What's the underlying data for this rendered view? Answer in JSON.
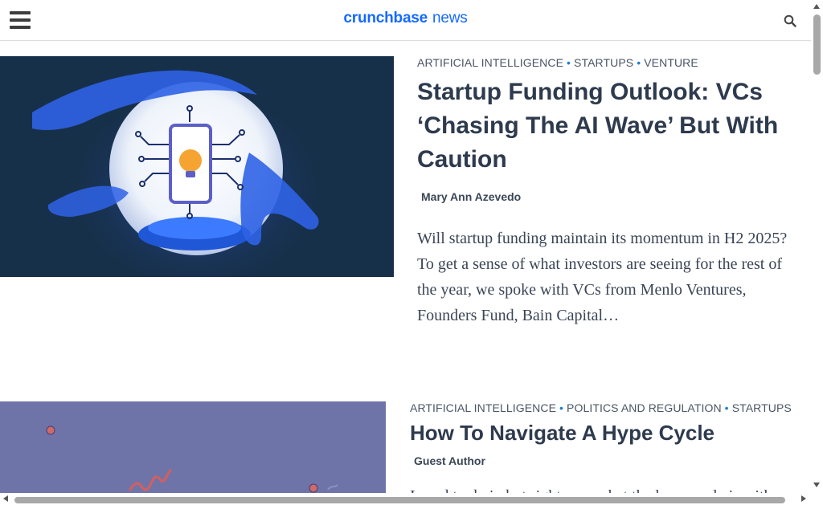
{
  "header": {
    "brand": "crunchbase",
    "news": "news",
    "menu_icon": "hamburger-menu-icon",
    "search_icon": "search-icon",
    "accent_color": "#146aff"
  },
  "articles": [
    {
      "categories": [
        "ARTIFICIAL INTELLIGENCE",
        "STARTUPS",
        "VENTURE"
      ],
      "title": "Startup Funding Outlook: VCs ‘Chasing The AI Wave’ But With Caution",
      "author": "Mary Ann Azevedo",
      "excerpt": "Will startup funding maintain its momentum in H2 2025? To get a sense of what investors are seeing for the rest of the year, we spoke with VCs from Menlo Ventures, Founders Fund, Bain Capital…"
    },
    {
      "categories": [
        "ARTIFICIAL INTELLIGENCE",
        "POLITICS AND REGULATION",
        "STARTUPS"
      ],
      "title": "How To Navigate A Hype Cycle",
      "author": "Guest Author",
      "excerpt": "I used to do in but right now what the hype cycle is with"
    }
  ]
}
